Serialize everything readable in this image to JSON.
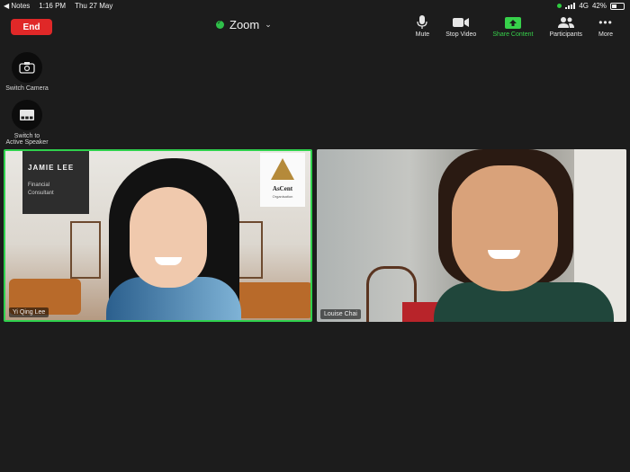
{
  "status_bar": {
    "back_app": "◀ Notes",
    "time": "1:16 PM",
    "date": "Thu 27 May",
    "network": "4G",
    "battery": "42%"
  },
  "meeting": {
    "end_label": "End",
    "title": "Zoom"
  },
  "toolbar": {
    "mute": "Mute",
    "stop_video": "Stop Video",
    "share_content": "Share Content",
    "participants": "Participants",
    "more": "More"
  },
  "side_actions": {
    "switch_camera": "Switch Camera",
    "switch_speaker_line1": "Switch to",
    "switch_speaker_line2": "Active Speaker"
  },
  "tiles": [
    {
      "participant": "Yi Qing Lee",
      "active_speaker": true,
      "banner_name": "JAMIE LEE",
      "banner_title_line1": "Financial",
      "banner_title_line2": "Consultant",
      "logo_text": "AsCent",
      "logo_sub": "Organisation"
    },
    {
      "participant": "Louise Chai",
      "active_speaker": false
    }
  ],
  "colors": {
    "end_button": "#e02828",
    "active_border": "#2fd14d",
    "share_green": "#37d14b",
    "background": "#1c1c1c"
  }
}
